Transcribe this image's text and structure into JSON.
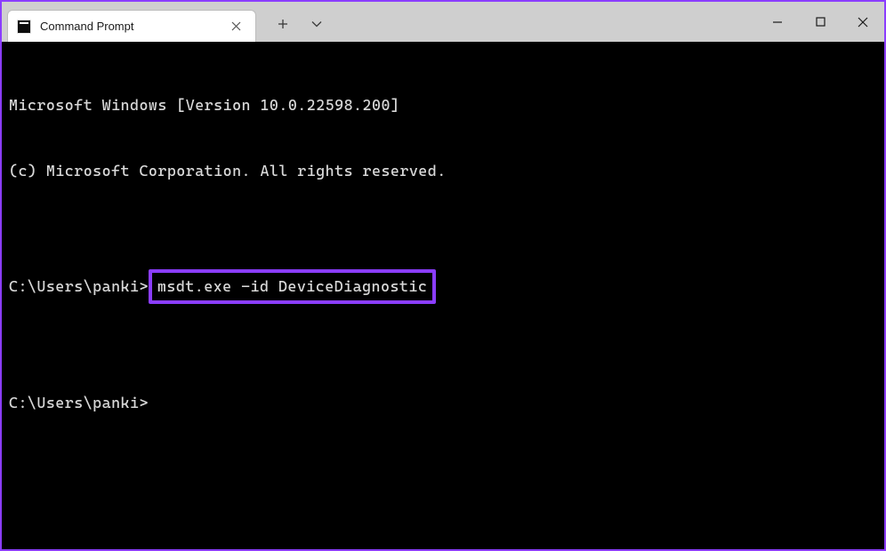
{
  "window": {
    "tab": {
      "title": "Command Prompt"
    }
  },
  "terminal": {
    "line1": "Microsoft Windows [Version 10.0.22598.200]",
    "line2": "(c) Microsoft Corporation. All rights reserved.",
    "blank1": "",
    "prompt1_prefix": "C:\\Users\\panki>",
    "prompt1_command": "msdt.exe -id DeviceDiagnostic",
    "blank2": "",
    "prompt2": "C:\\Users\\panki>"
  }
}
